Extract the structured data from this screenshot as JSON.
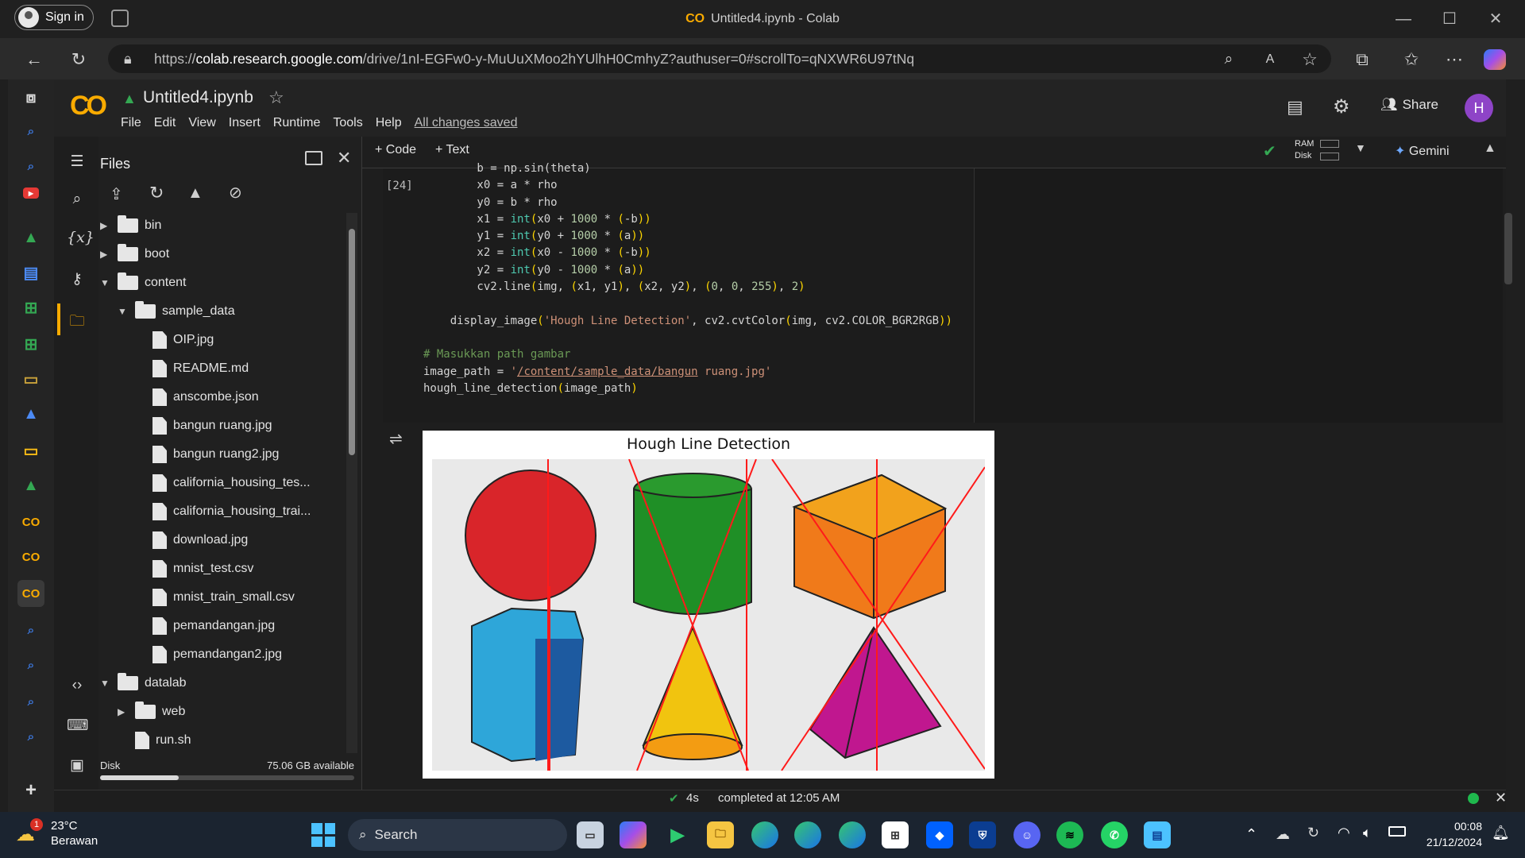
{
  "browser": {
    "signin_label": "Sign in",
    "window_title": "Untitled4.ipynb - Colab",
    "url_scheme": "https://",
    "url_domain": "colab.research.google.com",
    "url_path": "/drive/1nI-EGFw0-y-MuUuXMoo2hYUlhH0CmhyZ?authuser=0#scrollTo=qNXWR6U97tNq"
  },
  "colab": {
    "notebook_title": "Untitled4.ipynb",
    "menus": [
      "File",
      "Edit",
      "View",
      "Insert",
      "Runtime",
      "Tools",
      "Help"
    ],
    "saved_status": "All changes saved",
    "share_label": "Share",
    "avatar_letter": "H",
    "add_code": "+ Code",
    "add_text": "+ Text",
    "ram_label": "RAM",
    "disk_label": "Disk",
    "gemini_label": "Gemini"
  },
  "files_panel": {
    "title": "Files",
    "tree": [
      {
        "name": "bin",
        "type": "folder",
        "caret": "▶",
        "level": 0
      },
      {
        "name": "boot",
        "type": "folder",
        "caret": "▶",
        "level": 0
      },
      {
        "name": "content",
        "type": "folder",
        "caret": "▼",
        "level": 0
      },
      {
        "name": "sample_data",
        "type": "folder",
        "caret": "▼",
        "level": 1
      },
      {
        "name": "OIP.jpg",
        "type": "file",
        "level": 2
      },
      {
        "name": "README.md",
        "type": "file",
        "level": 2
      },
      {
        "name": "anscombe.json",
        "type": "file",
        "level": 2
      },
      {
        "name": "bangun ruang.jpg",
        "type": "file",
        "level": 2
      },
      {
        "name": "bangun ruang2.jpg",
        "type": "file",
        "level": 2
      },
      {
        "name": "california_housing_tes...",
        "type": "file",
        "level": 2
      },
      {
        "name": "california_housing_trai...",
        "type": "file",
        "level": 2
      },
      {
        "name": "download.jpg",
        "type": "file",
        "level": 2
      },
      {
        "name": "mnist_test.csv",
        "type": "file",
        "level": 2
      },
      {
        "name": "mnist_train_small.csv",
        "type": "file",
        "level": 2
      },
      {
        "name": "pemandangan.jpg",
        "type": "file",
        "level": 2
      },
      {
        "name": "pemandangan2.jpg",
        "type": "file",
        "level": 2
      },
      {
        "name": "datalab",
        "type": "folder",
        "caret": "▼",
        "level": 0
      },
      {
        "name": "web",
        "type": "folder",
        "caret": "▶",
        "level": 1
      },
      {
        "name": "run.sh",
        "type": "file",
        "level": 1
      }
    ],
    "disk_label": "Disk",
    "disk_available": "75.06 GB available",
    "disk_used_fraction": 0.31
  },
  "cell": {
    "exec_count": "[24]",
    "output_title": "Hough Line Detection"
  },
  "status_bar": {
    "duration": "4s",
    "completed": "completed at 12:05 AM"
  },
  "taskbar": {
    "weather_temp": "23°C",
    "weather_desc": "Berawan",
    "weather_badge": "1",
    "search_label": "Search",
    "time": "00:08",
    "date": "21/12/2024"
  }
}
